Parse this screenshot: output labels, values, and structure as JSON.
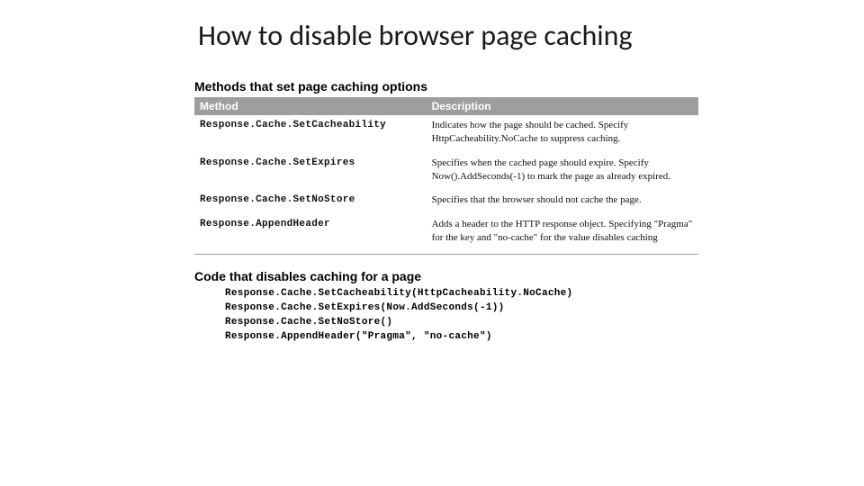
{
  "title": "How to disable browser page caching",
  "section1_title": "Methods that set page caching options",
  "table": {
    "headers": {
      "method": "Method",
      "description": "Description"
    },
    "rows": [
      {
        "method": "Response.Cache.SetCacheability",
        "description": "Indicates how the page should be cached. Specify HttpCacheability.NoCache to suppress caching."
      },
      {
        "method": "Response.Cache.SetExpires",
        "description": "Specifies when the cached page should expire. Specify Now().AddSeconds(-1) to mark the page as already expired."
      },
      {
        "method": "Response.Cache.SetNoStore",
        "description": "Specifies that the browser should not cache the page."
      },
      {
        "method": "Response.AppendHeader",
        "description": "Adds a header to the HTTP response object. Specifying \"Pragma\" for the key and \"no-cache\" for the value disables caching"
      }
    ]
  },
  "section2_title": "Code that disables caching for a page",
  "code": "Response.Cache.SetCacheability(HttpCacheability.NoCache)\nResponse.Cache.SetExpires(Now.AddSeconds(-1))\nResponse.Cache.SetNoStore()\nResponse.AppendHeader(\"Pragma\", \"no-cache\")"
}
